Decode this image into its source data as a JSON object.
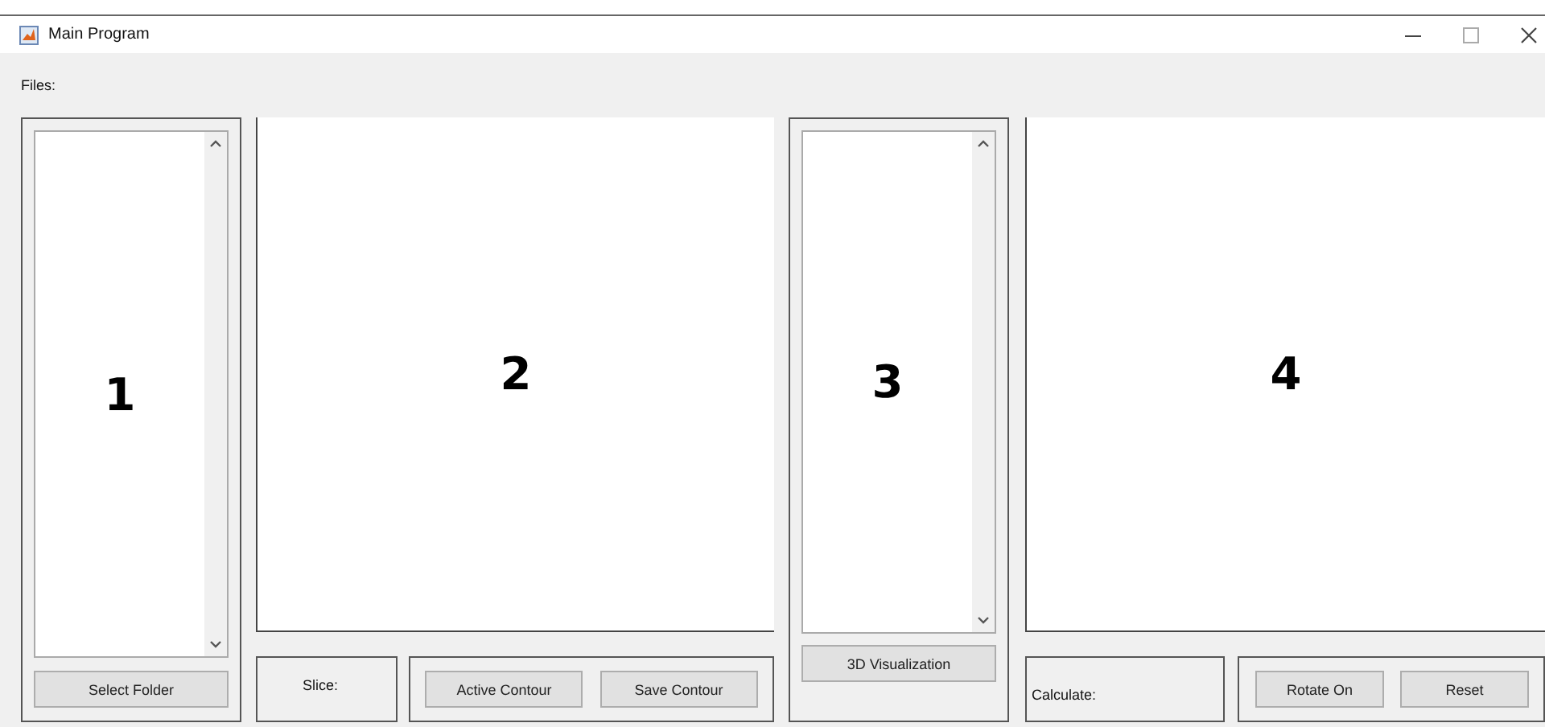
{
  "window": {
    "title": "Main Program"
  },
  "files_label": "Files:",
  "file_list": {
    "annotation": "1",
    "button": "Select Folder"
  },
  "axes_left": {
    "annotation": "2"
  },
  "slice_label": "Slice:",
  "contour_buttons": [
    "Active Contour",
    "Save Contour"
  ],
  "volume_list": {
    "annotation": "3",
    "button": "3D Visualization"
  },
  "axes_right": {
    "annotation": "4"
  },
  "calculate_label": "Calculate:",
  "view_buttons": [
    "Rotate On",
    "Reset"
  ]
}
